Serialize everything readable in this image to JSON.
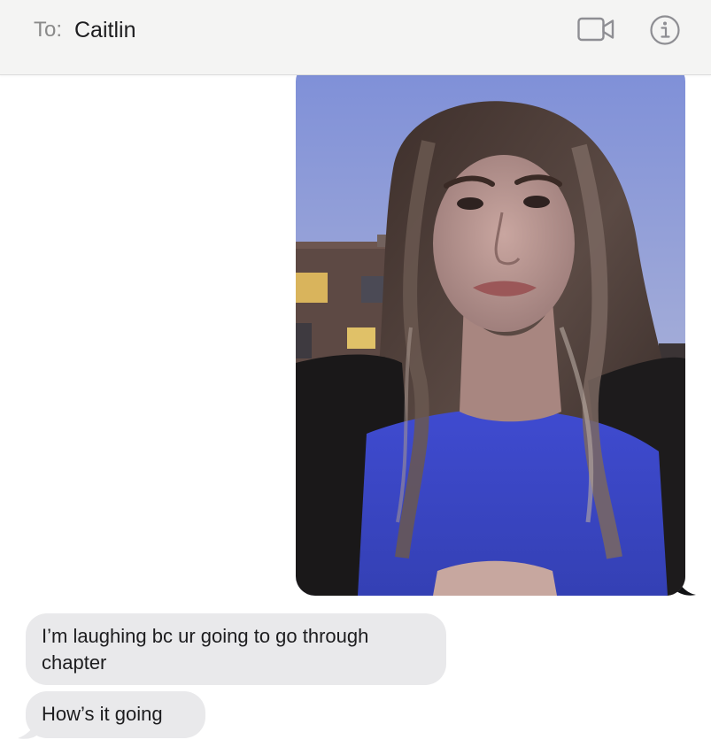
{
  "header": {
    "to_label": "To:",
    "recipient": "Caitlin",
    "video_icon": "video-camera-icon",
    "info_icon": "info-icon"
  },
  "conversation": {
    "sent_photo": {
      "kind": "selfie photo attachment"
    },
    "received": [
      {
        "text": "I’m laughing bc ur going to go through chapter"
      },
      {
        "text": "How’s it going"
      }
    ]
  },
  "colors": {
    "header_bg": "#f4f4f3",
    "received_bubble": "#e9e9eb",
    "icon_gray": "#8e8e93",
    "text": "#1d1d1f"
  }
}
